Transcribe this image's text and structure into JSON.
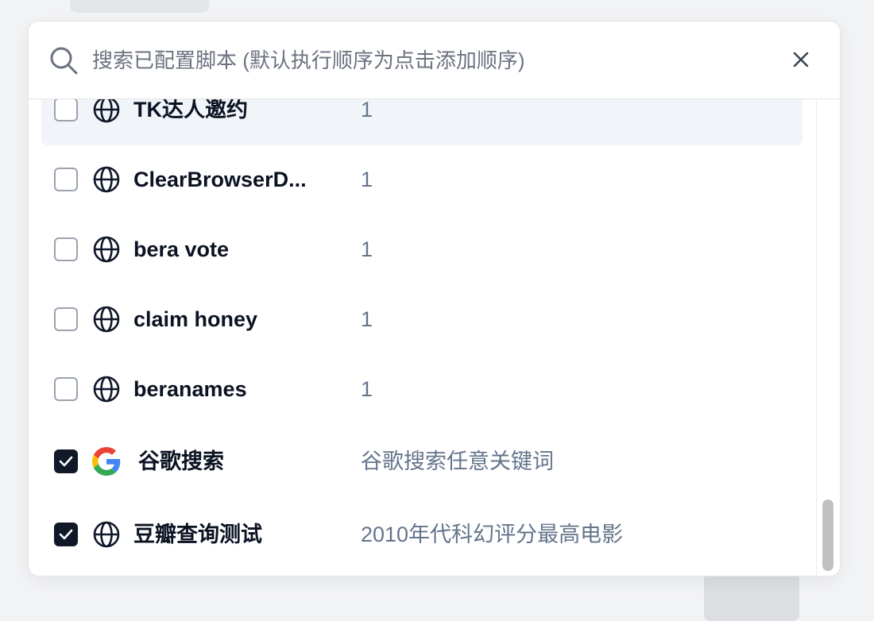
{
  "search": {
    "placeholder": "搜索已配置脚本 (默认执行顺序为点击添加顺序)",
    "value": ""
  },
  "items": [
    {
      "name": "TK达人邀约",
      "description": "1",
      "icon": "globe-icon",
      "checked": false,
      "highlighted": true
    },
    {
      "name": "ClearBrowserD...",
      "description": "1",
      "icon": "globe-icon",
      "checked": false,
      "highlighted": false
    },
    {
      "name": "bera vote",
      "description": "1",
      "icon": "globe-icon",
      "checked": false,
      "highlighted": false
    },
    {
      "name": "claim honey",
      "description": "1",
      "icon": "globe-icon",
      "checked": false,
      "highlighted": false
    },
    {
      "name": "beranames",
      "description": "1",
      "icon": "globe-icon",
      "checked": false,
      "highlighted": false
    },
    {
      "name": "谷歌搜索",
      "description": "谷歌搜索任意关键词",
      "icon": "google-icon",
      "checked": true,
      "highlighted": false
    },
    {
      "name": "豆瓣查询测试",
      "description": "2010年代科幻评分最高电影",
      "icon": "globe-icon",
      "checked": true,
      "highlighted": false
    }
  ],
  "colors": {
    "checked": "#111827",
    "highlight": "#f1f5f9",
    "description": "#64748b"
  }
}
